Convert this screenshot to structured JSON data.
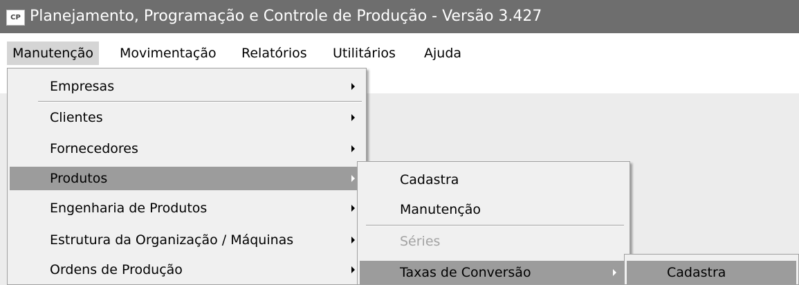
{
  "window": {
    "title": "Planejamento, Programação e Controle de Produção - Versão 3.427",
    "icon": "cp-app-icon",
    "icon_text": "CP"
  },
  "menubar": {
    "items": [
      {
        "label": "Manutenção"
      },
      {
        "label": "Movimentação"
      },
      {
        "label": "Relatórios"
      },
      {
        "label": "Utilitários"
      },
      {
        "label": "Ajuda"
      }
    ]
  },
  "menu_manutencao": {
    "items": [
      {
        "label": "Empresas"
      },
      {
        "label": "Clientes"
      },
      {
        "label": "Fornecedores"
      },
      {
        "label": "Produtos"
      },
      {
        "label": "Engenharia de Produtos"
      },
      {
        "label": "Estrutura da Organização / Máquinas"
      },
      {
        "label": "Ordens de Produção"
      }
    ]
  },
  "menu_produtos": {
    "items": [
      {
        "label": "Cadastra"
      },
      {
        "label": "Manutenção"
      },
      {
        "label": "Séries"
      },
      {
        "label": "Taxas de Conversão"
      }
    ]
  },
  "menu_taxas": {
    "items": [
      {
        "label": "Cadastra"
      }
    ]
  },
  "colors": {
    "titlebar": "#6e6e6e",
    "menu_bg": "#f0f0f0",
    "highlight": "#9c9c9c",
    "workspace": "#ececec"
  }
}
